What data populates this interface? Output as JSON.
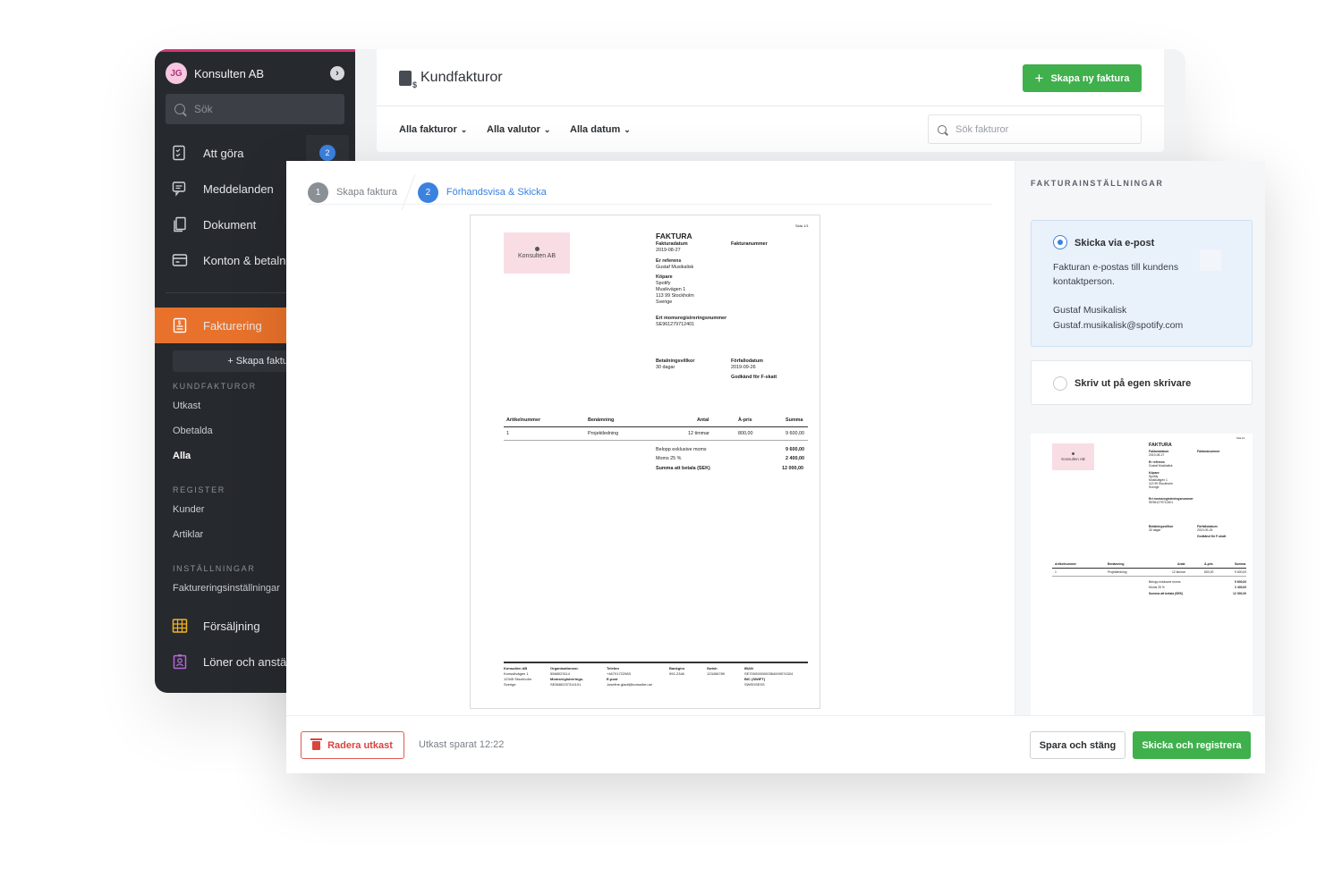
{
  "sidebar": {
    "avatar_initials": "JG",
    "org_name": "Konsulten AB",
    "search_placeholder": "Sök",
    "nav": [
      {
        "label": "Att göra",
        "badge": "2",
        "icon": "checklist-icon"
      },
      {
        "label": "Meddelanden",
        "icon": "messages-icon"
      },
      {
        "label": "Dokument",
        "icon": "documents-icon"
      },
      {
        "label": "Konton & betalningar",
        "icon": "wallet-icon"
      }
    ],
    "active": {
      "label": "Fakturering",
      "icon": "invoice-icon"
    },
    "create_invoice": "+ Skapa faktura",
    "sections": [
      {
        "heading": "KUNDFAKTUROR",
        "links": [
          "Utkast",
          "Obetalda",
          "Alla"
        ]
      },
      {
        "heading": "REGISTER",
        "links": [
          "Kunder",
          "Artiklar"
        ]
      },
      {
        "heading": "INSTÄLLNINGAR",
        "links": [
          "Faktureringsinställningar"
        ]
      }
    ],
    "bottom_nav": [
      {
        "label": "Försäljning",
        "icon": "sales-chart-icon",
        "color": "#f0b323"
      },
      {
        "label": "Löner och anställda",
        "icon": "employee-badge-icon",
        "color": "#b36ad6"
      }
    ],
    "colors": {
      "background": "#26292e",
      "active": "#e8722b",
      "accent": "#d6337a"
    }
  },
  "header": {
    "title": "Kundfakturor",
    "new_button": "Skapa ny faktura",
    "filters": [
      "Alla fakturor",
      "Alla valutor",
      "Alla datum"
    ],
    "search_placeholder": "Sök fakturor"
  },
  "steps": [
    {
      "num": "1",
      "label": "Skapa faktura",
      "state": "done"
    },
    {
      "num": "2",
      "label": "Förhandsvisa & Skicka",
      "state": "current"
    }
  ],
  "invoice": {
    "page": "Sida 1/1",
    "logo_text": "Konsulten AB",
    "title": "FAKTURA",
    "date_label": "Fakturadatum",
    "date": "2019-08-27",
    "number_label": "Fakturanummer",
    "ref_label": "Er referens",
    "ref": "Gustaf Musikalisk",
    "buyer_label": "Köpare",
    "buyer": [
      "Spotify",
      "Musikvägen 1",
      "113 99 Stockholm",
      "Sverige"
    ],
    "vat_label": "Ert momsregistreringsnummer",
    "vat": "SE961279712401",
    "terms_label": "Betalningsvillkor",
    "terms": "30 dagar",
    "due_label": "Förfallodatum",
    "due": "2019-09-26",
    "f_tax": "Godkänd för F-skatt",
    "columns": [
      "Artikelnummer",
      "Benämning",
      "Antal",
      "À-pris",
      "Summa"
    ],
    "rows": [
      [
        "1",
        "Projektledning",
        "12 timmar",
        "800,00",
        "9 600,00"
      ]
    ],
    "totals": [
      {
        "label": "Belopp exklusive moms",
        "value": "9 600,00"
      },
      {
        "label": "Moms 25 %",
        "value": "2 400,00"
      },
      {
        "label": "Summa att betala (SEK)",
        "value": "12 000,00"
      }
    ],
    "footer": [
      {
        "head": "Konsulten AB",
        "lines": [
          "Konsultvägen 1",
          "12345 Stockholm",
          "Sverige"
        ]
      },
      {
        "head": "Organisationsnr.",
        "lines": [
          "5568023114",
          "Momsregistrerings.",
          "SE5680237314101"
        ]
      },
      {
        "head": "Telefon",
        "lines": [
          "+46701722983",
          "E-post",
          "Josefine.gladi@konsulten.se"
        ]
      },
      {
        "head": "Bankgiro",
        "lines": [
          "991-2346"
        ]
      },
      {
        "head": "Swish",
        "lines": [
          "123456789"
        ]
      },
      {
        "head": "IBAN",
        "lines": [
          "SE7000000000354000074324",
          "BIC (SWIFT)",
          "SWEDSESS"
        ]
      }
    ]
  },
  "settings": {
    "title": "FAKTURAINSTÄLLNINGAR",
    "email_option": "Skicka via e-post",
    "email_desc_1": "Fakturan e-postas till kundens",
    "email_desc_2": "kontaktperson.",
    "contact_name": "Gustaf Musikalisk",
    "contact_email": "Gustaf.musikalisk@spotify.com",
    "print_option": "Skriv ut på egen skrivare"
  },
  "footer": {
    "delete": "Radera utkast",
    "saved": "Utkast sparat 12:22",
    "save_close": "Spara och stäng",
    "send": "Skicka och registrera"
  },
  "colors": {
    "green": "#3fb04c",
    "blue": "#3b82e0",
    "red": "#d9443e",
    "logo_pink": "#f9dde4"
  }
}
